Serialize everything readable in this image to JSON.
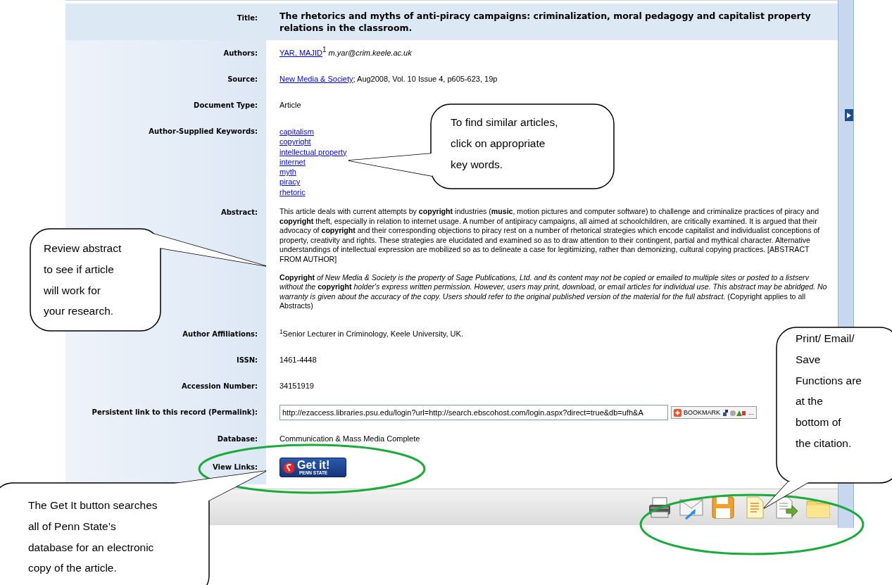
{
  "record": {
    "fields": [
      {
        "kind": "title",
        "label": "Title:",
        "value": "The rhetorics and myths of anti-piracy campaigns: criminalization, moral pedagogy and capitalist property relations in the classroom."
      },
      {
        "kind": "authors",
        "label": "Authors:",
        "author": "YAR, MAJID",
        "mark": "1",
        "email": "m.yar@crim.keele.ac.uk"
      },
      {
        "kind": "source",
        "label": "Source:",
        "link": "New Media & Society",
        "text": "; Aug2008, Vol. 10 Issue 4, p605-623, 19p"
      },
      {
        "kind": "text",
        "label": "Document Type:",
        "value": "Article"
      },
      {
        "kind": "links",
        "label": "Author-Supplied Keywords:",
        "items": [
          "capitalism",
          "copyright",
          "intellectual property",
          "internet",
          "myth",
          "piracy",
          "rhetoric"
        ]
      },
      {
        "kind": "abstract",
        "label": "Abstract:",
        "paragraphs": [
          "This article deals with current attempts by **copyright** industries (**music**, motion pictures and computer software) to challenge and criminalize practices of piracy and **copyright** theft, especially in relation to internet usage. A number of antipiracy campaigns, all aimed at schoolchildren, are critically examined. It is argued that their advocacy of **copyright** and their corresponding objections to piracy rest on a number of rhetorical strategies which encode capitalist and individualist conceptions of property, creativity and rights. These strategies are elucidated and examined so as to draw attention to their contingent, partial and mythical character. Alternative understandings of intellectual expression are mobilized so as to delineate a case for legitimizing, rather than demonizing, cultural copying practices. [ABSTRACT FROM AUTHOR]",
          "**Copyright** *of New Media & Society is the property of Sage Publications, Ltd. and its content may not be copied or emailed to multiple sites or posted to a listserv without the* **copyright** *holder's express written permission. However, users may print, download, or email articles for individual use. This abstract may be abridged. No warranty is given about the accuracy of the copy. Users should refer to the original published version of the material for the full abstract.* (Copyright applies to all Abstracts)"
        ]
      },
      {
        "kind": "affiliation",
        "label": "Author Affiliations:",
        "value": "$^{1}$Senior Lecturer in Criminology, Keele University, UK."
      },
      {
        "kind": "text",
        "label": "ISSN:",
        "value": "1461-4448"
      },
      {
        "kind": "text",
        "label": "Accession Number:",
        "value": "34151919"
      },
      {
        "kind": "permalink",
        "label": "Persistent link to this record (Permalink):",
        "value": "http://ezaccess.libraries.psu.edu/login?url=http://search.ebscohost.com/login.aspx?direct=true&db=ufh&A",
        "bookmark": "BOOKMARK",
        "more": "..."
      },
      {
        "kind": "text",
        "label": "Database:",
        "value": "Communication & Mass Media Complete"
      },
      {
        "kind": "button",
        "label": "View Links:",
        "title": "Get it!",
        "subtitle": "PENN STATE"
      }
    ]
  },
  "callouts": [
    {
      "lines": [
        "To find similar articles,",
        "click on appropriate",
        "key words."
      ]
    },
    {
      "lines": [
        "Review abstract",
        "to see if article",
        "will work for",
        "your research."
      ]
    },
    {
      "lines": [
        "Print/ Email/",
        "Save",
        "Functions are",
        "at the",
        "bottom of",
        "the citation."
      ]
    },
    {
      "lines": [
        "The Get It button searches",
        "all of Penn State’s",
        "database for an electronic",
        "copy of the article."
      ]
    }
  ]
}
